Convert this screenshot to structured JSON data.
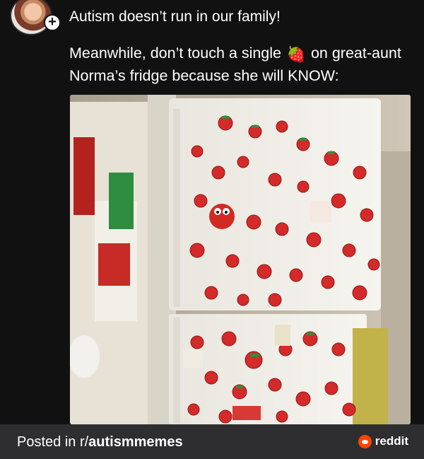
{
  "post": {
    "line1": "Autism doesn’t run in our family!",
    "line2_before": "Meanwhile, don’t touch a single ",
    "emoji": "🍓",
    "line2_after": " on great-aunt Norma’s fridge because she will KNOW:"
  },
  "avatar": {
    "plus_label": "+"
  },
  "footer": {
    "posted_in": "Posted in r/",
    "subreddit": "autismmemes",
    "brand": "reddit"
  },
  "colors": {
    "background": "#111112",
    "footer_bg": "#2e2e30",
    "reddit_orange": "#ff4500",
    "strawberry_red": "#d42a2a"
  },
  "icons": [
    "follow-plus-icon",
    "strawberry-emoji",
    "reddit-logo-icon"
  ]
}
